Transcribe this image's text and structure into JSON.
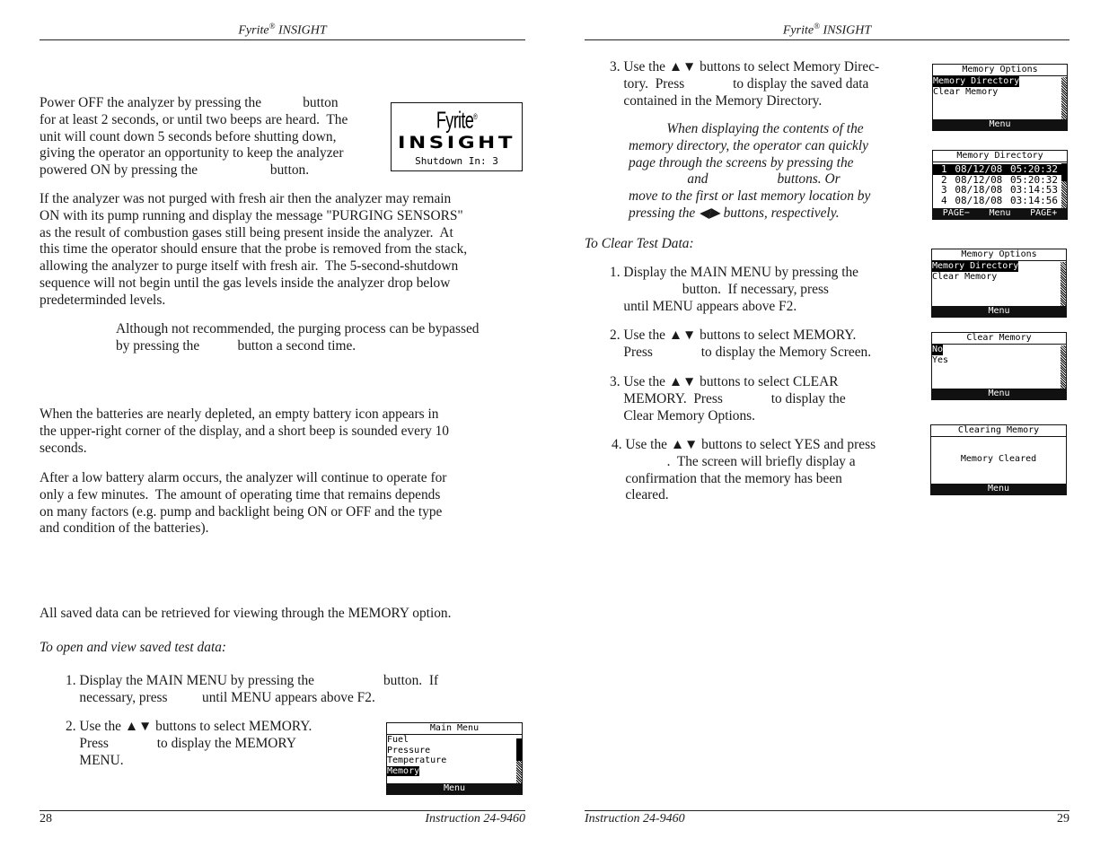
{
  "left_page": {
    "running_head": {
      "brand": "Fyrite",
      "reg": "®",
      "product": " INSIGHT"
    },
    "poweroff_para": [
      "Power OFF the analyzer by pressing the            button",
      "for at least 2 seconds, or until two beeps are heard.  The",
      "unit will count down 5 seconds before shutting down,",
      "giving the operator an opportunity to keep the analyzer",
      "powered ON by pressing the                     button."
    ],
    "splash_screen": {
      "brand_line1": "Fyrite",
      "reg": "®",
      "brand_line2": "INSIGHT",
      "message": "Shutdown In: 3"
    },
    "purge_para": [
      "If the analyzer was not purged with fresh air then the analyzer may remain",
      "ON with its pump running and display the message \"PURGING SENSORS\"",
      "as the result of combustion gases still being present inside the analyzer.  At",
      "this time the operator should ensure that the probe is removed from the stack,",
      "allowing the analyzer to purge itself with fresh air.  The 5-second-shutdown",
      "sequence will not begin until the gas levels inside the analyzer drop below",
      "predeterminded levels."
    ],
    "note_para": [
      "Although not recommended, the purging process can be bypassed",
      "by pressing the           button a second time."
    ],
    "battery_para1": [
      "When the batteries are nearly depleted, an empty battery icon appears in",
      "the upper-right corner of the display, and a short beep is sounded every 10",
      "seconds."
    ],
    "battery_para2": [
      "After a low battery alarm occurs, the analyzer will continue to operate for",
      "only a few minutes.  The amount of operating time that remains depends",
      "on many factors (e.g. pump and backlight being ON or OFF and the type",
      "and condition of the batteries)."
    ],
    "memory_intro": "All saved data can be retrieved for viewing through the MEMORY option.",
    "open_heading": "To open and view saved test data:",
    "step1": [
      "1. Display the MAIN MENU by pressing the                    button.  If",
      "    necessary, press          until MENU appears above F2."
    ],
    "step2": [
      "2. Use the ▲▼ buttons to select MEMORY.",
      "    Press              to display the MEMORY",
      "    MENU."
    ],
    "main_menu_screen": {
      "title": "Main Menu",
      "items": [
        "Fuel",
        "Pressure",
        "Temperature",
        "Memory"
      ],
      "selected_index": 3,
      "bar": "Menu"
    },
    "footer": {
      "page_number": "28",
      "doc_id": "Instruction 24-9460"
    }
  },
  "right_page": {
    "running_head": {
      "brand": "Fyrite",
      "reg": "®",
      "product": " INSIGHT"
    },
    "step3": [
      "3. Use the ▲▼ buttons to select Memory Direc-",
      "    tory.  Press              to display the saved data",
      "    contained in the Memory Directory."
    ],
    "memory_options_screen": {
      "title": "Memory Options",
      "items": [
        "Memory Directory",
        "Clear Memory"
      ],
      "selected_index": 0,
      "bar": "Menu"
    },
    "note_para": [
      "           When displaying the contents of the",
      "memory directory, the operator can quickly",
      "page through the screens by pressing the",
      "                 and                    buttons. Or",
      "move to the first or last memory location by",
      "pressing the ◀▶ buttons, respectively."
    ],
    "memory_directory_screen": {
      "title": "Memory Directory",
      "rows": [
        {
          "index": "1",
          "date": "08/12/08",
          "time": "05:20:32"
        },
        {
          "index": "2",
          "date": "08/12/08",
          "time": "05:20:32"
        },
        {
          "index": "3",
          "date": "08/18/08",
          "time": "03:14:53"
        },
        {
          "index": "4",
          "date": "08/18/08",
          "time": "03:14:56"
        }
      ],
      "selected_index": 0,
      "bar": [
        "PAGE−",
        "Menu",
        "PAGE+"
      ]
    },
    "clear_heading": "To Clear Test Data:",
    "clear_step1": [
      "1. Display the MAIN MENU by pressing the",
      "                     button.  If necessary, press",
      "    until MENU appears above F2."
    ],
    "memory_options_screen_2": {
      "title": "Memory Options",
      "items": [
        "Memory Directory",
        "Clear Memory"
      ],
      "selected_index": 0,
      "bar": "Menu"
    },
    "clear_step2": [
      "2. Use the ▲▼ buttons to select MEMORY.",
      "    Press              to display the Memory Screen."
    ],
    "clear_memory_screen": {
      "title": "Clear Memory",
      "items": [
        "No",
        "Yes"
      ],
      "selected_index": 0,
      "bar": "Menu"
    },
    "clear_step3": [
      "3. Use the ▲▼ buttons to select CLEAR",
      "    MEMORY.  Press              to display the",
      "    Clear Memory Options."
    ],
    "clear_step4": [
      "4. Use the ▲▼ buttons to select YES and press",
      "                .  The screen will briefly display a",
      "    confirmation that the memory has been",
      "    cleared."
    ],
    "clearing_screen": {
      "title": "Clearing Memory",
      "message": "Memory Cleared",
      "bar": "Menu"
    },
    "footer": {
      "doc_id": "Instruction 24-9460",
      "page_number": "29"
    }
  }
}
